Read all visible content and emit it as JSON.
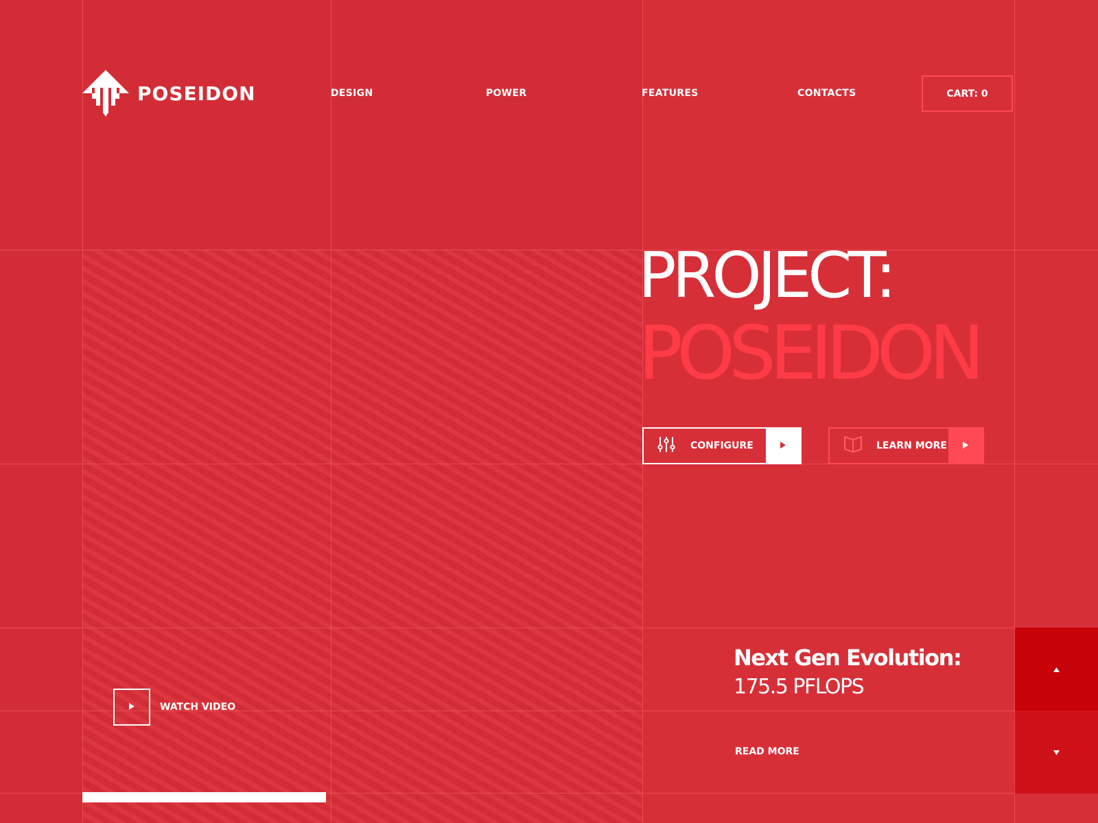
{
  "brand": {
    "name": "POSEIDON",
    "logo_icon": "trident-arrow-icon"
  },
  "nav": {
    "items": [
      {
        "label": "DESIGN"
      },
      {
        "label": "POWER"
      },
      {
        "label": "FEATURES"
      },
      {
        "label": "CONTACTS"
      }
    ],
    "cart_label": "CART: 0"
  },
  "hero": {
    "title_line1": "PROJECT:",
    "title_line2": "POSEIDON",
    "configure": {
      "label": "CONFIGURE",
      "icon": "sliders-icon",
      "arrow_icon": "play-arrow-icon"
    },
    "learn_more": {
      "label": "LEARN MORE",
      "icon": "book-icon",
      "arrow_icon": "play-arrow-icon"
    }
  },
  "video": {
    "label": "WATCH VIDEO",
    "icon": "play-icon"
  },
  "slider": {
    "progress_fraction": 0.435
  },
  "news": {
    "title": "Next Gen Evolution:",
    "value": "175.5 PFLOPS",
    "read_more": "READ MORE",
    "prev_icon": "triangle-up-icon",
    "next_icon": "triangle-down-icon"
  },
  "colors": {
    "background": "#d72f38",
    "background_dark": "#d22d36",
    "accent": "#ff3b47",
    "button_accent": "#ff4a55",
    "nav_up_bg": "#c70208",
    "nav_down_bg": "#cf1119",
    "text": "#ffffff"
  }
}
